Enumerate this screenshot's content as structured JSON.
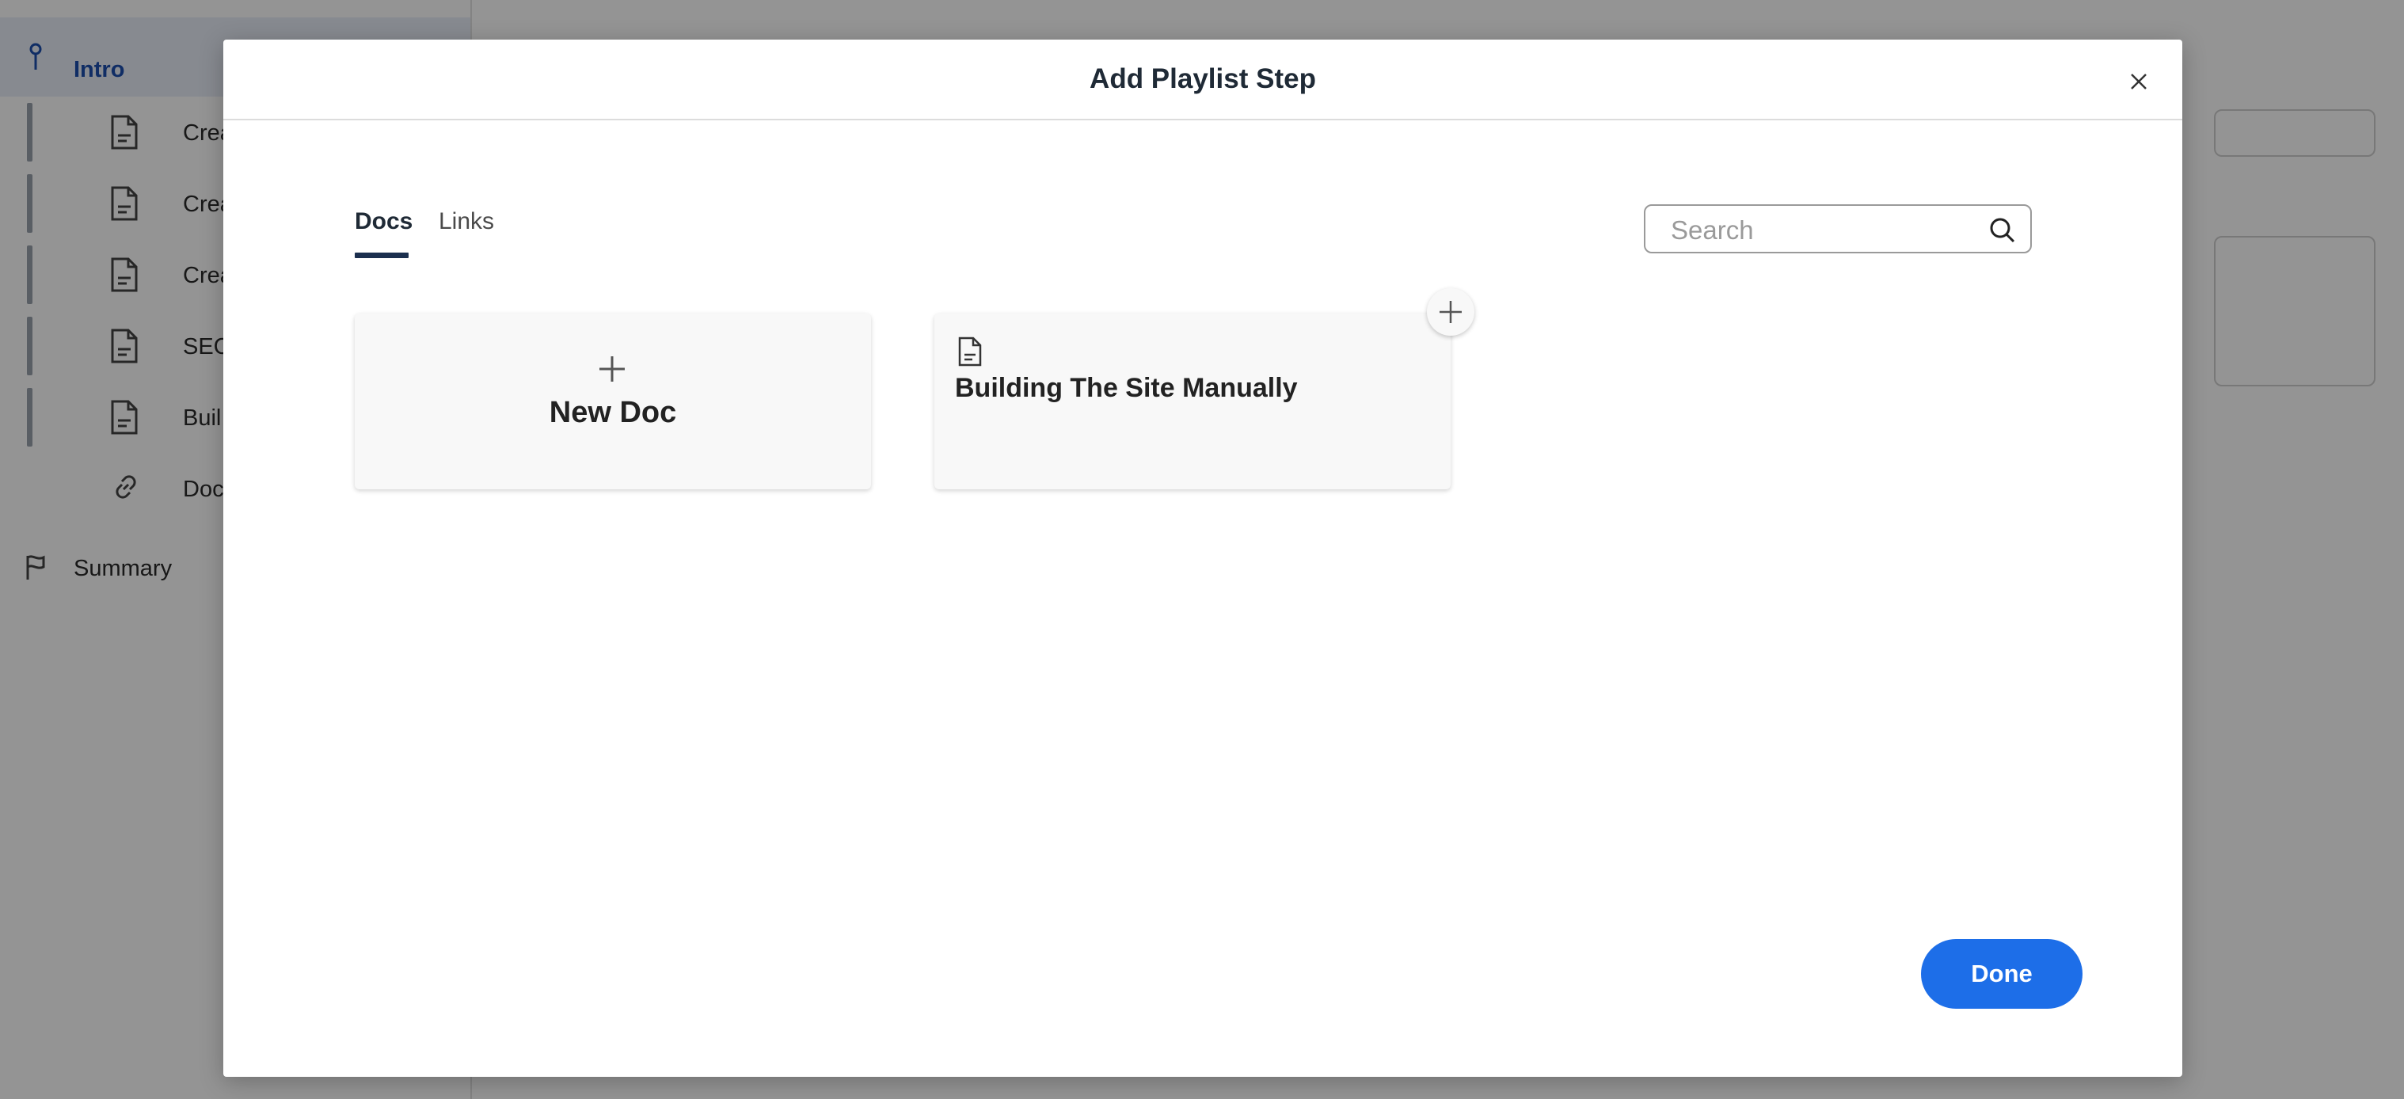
{
  "sidebar": {
    "intro_label": "Intro",
    "steps": [
      {
        "label": "Crea",
        "icon": "document-icon"
      },
      {
        "label": "Crea",
        "icon": "document-icon"
      },
      {
        "label": "Crea",
        "icon": "document-icon"
      },
      {
        "label": "SEC",
        "icon": "document-icon"
      },
      {
        "label": "Buil",
        "icon": "document-icon"
      },
      {
        "label": "Doc",
        "icon": "link-icon"
      }
    ],
    "summary_label": "Summary"
  },
  "modal": {
    "title": "Add Playlist Step",
    "tabs": [
      {
        "label": "Docs",
        "active": true
      },
      {
        "label": "Links",
        "active": false
      }
    ],
    "search": {
      "placeholder": "Search",
      "value": ""
    },
    "cards": {
      "new_doc": {
        "label": "New Doc"
      },
      "doc": {
        "label": "Building The Site Manually"
      }
    },
    "done_label": "Done"
  },
  "colors": {
    "accent": "#1d6ee8",
    "tab_underline": "#1b2f4e",
    "sidebar_active": "#1d4fae"
  }
}
